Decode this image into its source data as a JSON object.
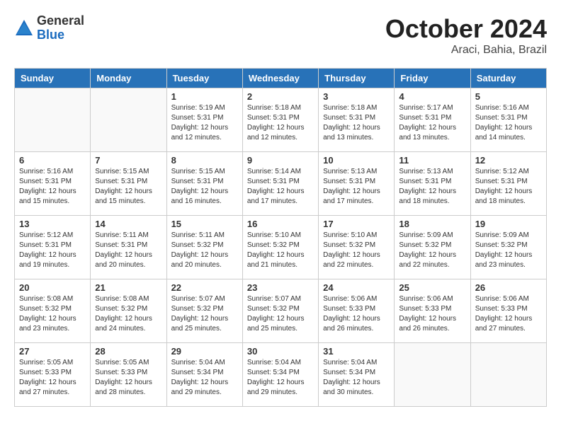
{
  "header": {
    "logo_general": "General",
    "logo_blue": "Blue",
    "month_title": "October 2024",
    "location": "Araci, Bahia, Brazil"
  },
  "columns": [
    "Sunday",
    "Monday",
    "Tuesday",
    "Wednesday",
    "Thursday",
    "Friday",
    "Saturday"
  ],
  "weeks": [
    [
      {
        "day": "",
        "detail": ""
      },
      {
        "day": "",
        "detail": ""
      },
      {
        "day": "1",
        "detail": "Sunrise: 5:19 AM\nSunset: 5:31 PM\nDaylight: 12 hours\nand 12 minutes."
      },
      {
        "day": "2",
        "detail": "Sunrise: 5:18 AM\nSunset: 5:31 PM\nDaylight: 12 hours\nand 12 minutes."
      },
      {
        "day": "3",
        "detail": "Sunrise: 5:18 AM\nSunset: 5:31 PM\nDaylight: 12 hours\nand 13 minutes."
      },
      {
        "day": "4",
        "detail": "Sunrise: 5:17 AM\nSunset: 5:31 PM\nDaylight: 12 hours\nand 13 minutes."
      },
      {
        "day": "5",
        "detail": "Sunrise: 5:16 AM\nSunset: 5:31 PM\nDaylight: 12 hours\nand 14 minutes."
      }
    ],
    [
      {
        "day": "6",
        "detail": "Sunrise: 5:16 AM\nSunset: 5:31 PM\nDaylight: 12 hours\nand 15 minutes."
      },
      {
        "day": "7",
        "detail": "Sunrise: 5:15 AM\nSunset: 5:31 PM\nDaylight: 12 hours\nand 15 minutes."
      },
      {
        "day": "8",
        "detail": "Sunrise: 5:15 AM\nSunset: 5:31 PM\nDaylight: 12 hours\nand 16 minutes."
      },
      {
        "day": "9",
        "detail": "Sunrise: 5:14 AM\nSunset: 5:31 PM\nDaylight: 12 hours\nand 17 minutes."
      },
      {
        "day": "10",
        "detail": "Sunrise: 5:13 AM\nSunset: 5:31 PM\nDaylight: 12 hours\nand 17 minutes."
      },
      {
        "day": "11",
        "detail": "Sunrise: 5:13 AM\nSunset: 5:31 PM\nDaylight: 12 hours\nand 18 minutes."
      },
      {
        "day": "12",
        "detail": "Sunrise: 5:12 AM\nSunset: 5:31 PM\nDaylight: 12 hours\nand 18 minutes."
      }
    ],
    [
      {
        "day": "13",
        "detail": "Sunrise: 5:12 AM\nSunset: 5:31 PM\nDaylight: 12 hours\nand 19 minutes."
      },
      {
        "day": "14",
        "detail": "Sunrise: 5:11 AM\nSunset: 5:31 PM\nDaylight: 12 hours\nand 20 minutes."
      },
      {
        "day": "15",
        "detail": "Sunrise: 5:11 AM\nSunset: 5:32 PM\nDaylight: 12 hours\nand 20 minutes."
      },
      {
        "day": "16",
        "detail": "Sunrise: 5:10 AM\nSunset: 5:32 PM\nDaylight: 12 hours\nand 21 minutes."
      },
      {
        "day": "17",
        "detail": "Sunrise: 5:10 AM\nSunset: 5:32 PM\nDaylight: 12 hours\nand 22 minutes."
      },
      {
        "day": "18",
        "detail": "Sunrise: 5:09 AM\nSunset: 5:32 PM\nDaylight: 12 hours\nand 22 minutes."
      },
      {
        "day": "19",
        "detail": "Sunrise: 5:09 AM\nSunset: 5:32 PM\nDaylight: 12 hours\nand 23 minutes."
      }
    ],
    [
      {
        "day": "20",
        "detail": "Sunrise: 5:08 AM\nSunset: 5:32 PM\nDaylight: 12 hours\nand 23 minutes."
      },
      {
        "day": "21",
        "detail": "Sunrise: 5:08 AM\nSunset: 5:32 PM\nDaylight: 12 hours\nand 24 minutes."
      },
      {
        "day": "22",
        "detail": "Sunrise: 5:07 AM\nSunset: 5:32 PM\nDaylight: 12 hours\nand 25 minutes."
      },
      {
        "day": "23",
        "detail": "Sunrise: 5:07 AM\nSunset: 5:32 PM\nDaylight: 12 hours\nand 25 minutes."
      },
      {
        "day": "24",
        "detail": "Sunrise: 5:06 AM\nSunset: 5:33 PM\nDaylight: 12 hours\nand 26 minutes."
      },
      {
        "day": "25",
        "detail": "Sunrise: 5:06 AM\nSunset: 5:33 PM\nDaylight: 12 hours\nand 26 minutes."
      },
      {
        "day": "26",
        "detail": "Sunrise: 5:06 AM\nSunset: 5:33 PM\nDaylight: 12 hours\nand 27 minutes."
      }
    ],
    [
      {
        "day": "27",
        "detail": "Sunrise: 5:05 AM\nSunset: 5:33 PM\nDaylight: 12 hours\nand 27 minutes."
      },
      {
        "day": "28",
        "detail": "Sunrise: 5:05 AM\nSunset: 5:33 PM\nDaylight: 12 hours\nand 28 minutes."
      },
      {
        "day": "29",
        "detail": "Sunrise: 5:04 AM\nSunset: 5:34 PM\nDaylight: 12 hours\nand 29 minutes."
      },
      {
        "day": "30",
        "detail": "Sunrise: 5:04 AM\nSunset: 5:34 PM\nDaylight: 12 hours\nand 29 minutes."
      },
      {
        "day": "31",
        "detail": "Sunrise: 5:04 AM\nSunset: 5:34 PM\nDaylight: 12 hours\nand 30 minutes."
      },
      {
        "day": "",
        "detail": ""
      },
      {
        "day": "",
        "detail": ""
      }
    ]
  ]
}
